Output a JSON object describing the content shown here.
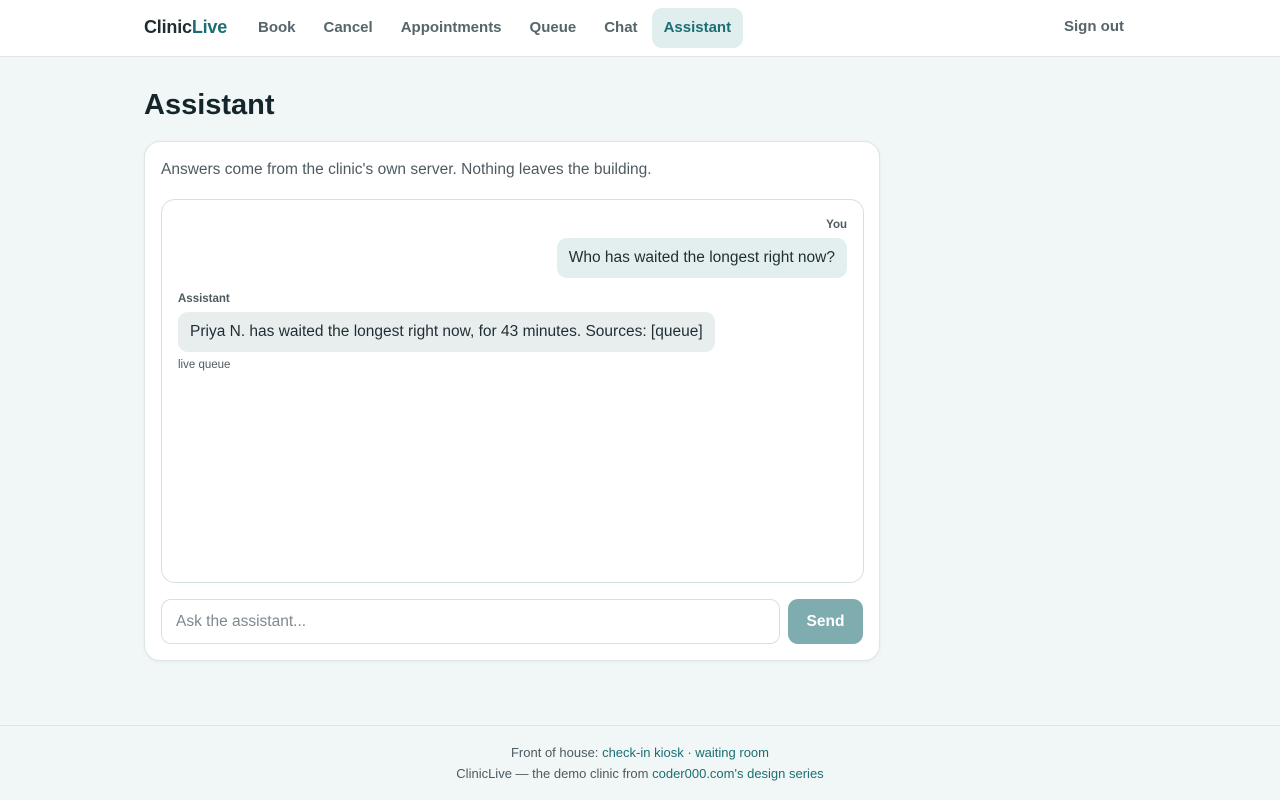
{
  "brand": {
    "name_part1": "Clinic",
    "name_part2": "Live"
  },
  "nav": {
    "items": [
      {
        "label": "Book"
      },
      {
        "label": "Cancel"
      },
      {
        "label": "Appointments"
      },
      {
        "label": "Queue"
      },
      {
        "label": "Chat"
      },
      {
        "label": "Assistant",
        "active": true
      }
    ],
    "signout_label": "Sign out"
  },
  "page": {
    "title": "Assistant"
  },
  "assistant": {
    "intro": "Answers come from the clinic's own server. Nothing leaves the building.",
    "messages": [
      {
        "role": "You",
        "text": "Who has waited the longest right now?"
      },
      {
        "role": "Assistant",
        "text": "Priya N. has waited the longest right now, for 43 minutes. Sources: [queue]",
        "source_note": "live queue"
      }
    ],
    "input": {
      "placeholder": "Ask the assistant...",
      "value": ""
    },
    "send_label": "Send"
  },
  "footer": {
    "line1_prefix": "Front of house:",
    "link_kiosk": "check-in kiosk",
    "separator": "·",
    "link_waiting_room": "waiting room",
    "line2_prefix": "ClinicLive — the demo clinic from",
    "link_design_series": "coder000.com's design series"
  },
  "colors": {
    "accent": "#1b6f74",
    "background": "#f1f6f6",
    "send_button": "#7eacaf",
    "active_tab_bg": "#e0eeee"
  }
}
